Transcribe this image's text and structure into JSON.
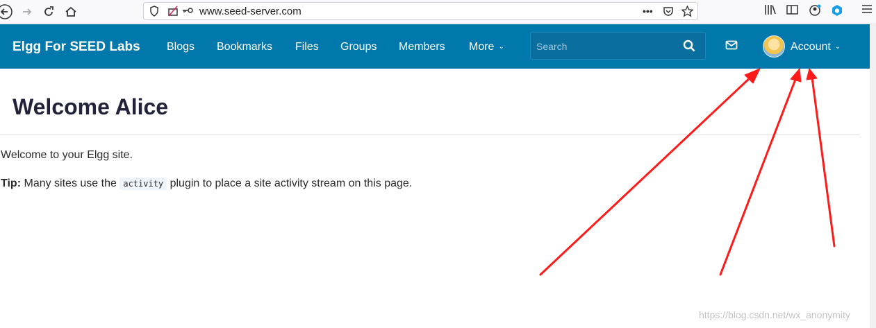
{
  "browser": {
    "url": "www.seed-server.com"
  },
  "topbar": {
    "brand": "Elgg For SEED Labs",
    "nav": [
      "Blogs",
      "Bookmarks",
      "Files",
      "Groups",
      "Members",
      "More"
    ],
    "search_placeholder": "Search",
    "account_label": "Account"
  },
  "page": {
    "title": "Welcome Alice",
    "welcome_text": "Welcome to your Elgg site.",
    "tip_label": "Tip:",
    "tip_before": "Many sites use the",
    "tip_code": "activity",
    "tip_after": "plugin to place a site activity stream on this page."
  },
  "watermark": "https://blog.csdn.net/wx_anonymity",
  "colors": {
    "topbar": "#0078ac",
    "annotation_arrows": "#ff1a1a"
  },
  "icons": [
    "back-icon",
    "forward-icon",
    "reload-icon",
    "home-icon",
    "shield-icon",
    "tracking-icon",
    "key-icon",
    "more-icon",
    "pocket-icon",
    "star-icon",
    "library-icon",
    "sidebar-icon",
    "profile-icon",
    "extension-icon",
    "menu-icon",
    "search-icon",
    "mail-icon"
  ]
}
